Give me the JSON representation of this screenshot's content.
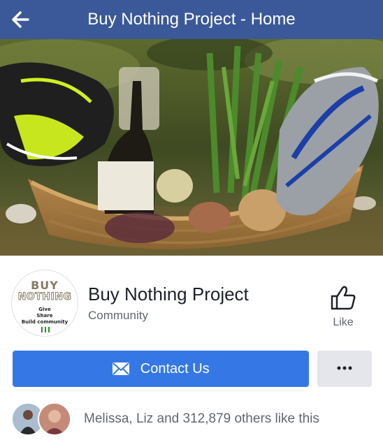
{
  "header": {
    "title": "Buy Nothing Project - Home",
    "back_icon": "arrow-left-icon",
    "background_color": "#3b5998"
  },
  "cover": {
    "description_icon": "cover-photo"
  },
  "page": {
    "logo_lines": [
      "BUY",
      "NOTHING",
      "Give",
      "Share",
      "Build community"
    ],
    "name": "Buy Nothing Project",
    "category": "Community"
  },
  "actions": {
    "like_label": "Like",
    "like_icon": "thumbs-up-icon",
    "contact_label": "Contact Us",
    "contact_icon": "envelope-icon",
    "contact_color": "#3578e5",
    "more_icon": "more-dots-icon"
  },
  "likes": {
    "text": "Melissa, Liz and 312,879 others like this"
  }
}
